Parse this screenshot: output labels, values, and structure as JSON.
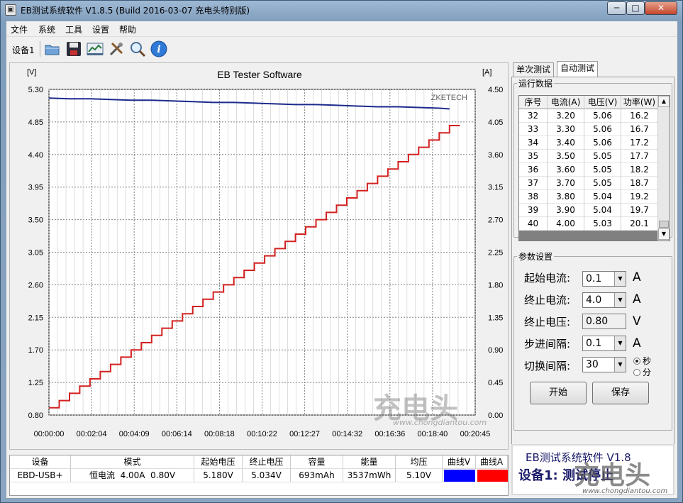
{
  "window": {
    "title": "EB测试系统软件 V1.8.5 (Build 2016-03-07 充电头特别版)",
    "controls": [
      "─",
      "□",
      "✕"
    ]
  },
  "menu": [
    "文件",
    "系统",
    "工具",
    "设置",
    "帮助"
  ],
  "toolbar": {
    "device_label": "设备1",
    "buttons": [
      "folder-icon",
      "save-icon",
      "chart-icon",
      "tools-icon",
      "zoom-icon",
      "info-icon"
    ]
  },
  "chart_data": {
    "type": "line",
    "title": "EB Tester Software",
    "brand_text": "ZKETECH",
    "left_unit": "[V]",
    "right_unit": "[A]",
    "y_left_ticks": [
      "5.30",
      "4.85",
      "4.40",
      "3.95",
      "3.50",
      "3.05",
      "2.60",
      "2.15",
      "1.70",
      "1.25",
      "0.80"
    ],
    "y_right_ticks": [
      "4.50",
      "4.05",
      "3.60",
      "3.15",
      "2.70",
      "2.25",
      "1.80",
      "1.35",
      "0.90",
      "0.45",
      "0.00"
    ],
    "x_ticks": [
      "00:00:00",
      "00:02:04",
      "00:04:09",
      "00:06:14",
      "00:08:18",
      "00:10:22",
      "00:12:27",
      "00:14:32",
      "00:16:36",
      "00:18:40",
      "00:20:45"
    ],
    "y_left_range": [
      0.8,
      5.3
    ],
    "y_right_range": [
      0.0,
      4.5
    ],
    "x_range_seconds": [
      0,
      1245
    ],
    "series": [
      {
        "name": "曲线V",
        "axis": "left",
        "color": "#1c2a8c",
        "x": [
          0,
          60,
          120,
          180,
          240,
          300,
          360,
          420,
          480,
          540,
          600,
          660,
          720,
          780,
          840,
          900,
          960,
          1020,
          1080,
          1140,
          1170
        ],
        "values": [
          5.18,
          5.17,
          5.17,
          5.16,
          5.15,
          5.15,
          5.14,
          5.13,
          5.12,
          5.12,
          5.11,
          5.1,
          5.09,
          5.09,
          5.08,
          5.07,
          5.06,
          5.06,
          5.05,
          5.04,
          5.03
        ]
      },
      {
        "name": "曲线A",
        "axis": "right",
        "color": "#d42020",
        "step": true,
        "step_seconds": 30,
        "start": 0.1,
        "increment": 0.1,
        "end": 4.0
      }
    ]
  },
  "tabs": [
    "单次测试",
    "自动测试"
  ],
  "run_data": {
    "group_title": "运行数据",
    "headers": [
      "序号",
      "电流(A)",
      "电压(V)",
      "功率(W)"
    ],
    "rows": [
      [
        "32",
        "3.20",
        "5.06",
        "16.2"
      ],
      [
        "33",
        "3.30",
        "5.06",
        "16.7"
      ],
      [
        "34",
        "3.40",
        "5.06",
        "17.2"
      ],
      [
        "35",
        "3.50",
        "5.05",
        "17.7"
      ],
      [
        "36",
        "3.60",
        "5.05",
        "18.2"
      ],
      [
        "37",
        "3.70",
        "5.05",
        "18.7"
      ],
      [
        "38",
        "3.80",
        "5.04",
        "19.2"
      ],
      [
        "39",
        "3.90",
        "5.04",
        "19.7"
      ],
      [
        "40",
        "4.00",
        "5.03",
        "20.1"
      ]
    ]
  },
  "params": {
    "group_title": "参数设置",
    "start_current": {
      "label": "起始电流:",
      "value": "0.1",
      "unit": "A"
    },
    "stop_current": {
      "label": "终止电流:",
      "value": "4.0",
      "unit": "A"
    },
    "stop_voltage": {
      "label": "终止电压:",
      "value": "0.80",
      "unit": "V"
    },
    "step_interval": {
      "label": "步进间隔:",
      "value": "0.1",
      "unit": "A"
    },
    "switch_interval": {
      "label": "切换间隔:",
      "value": "30"
    },
    "unit_sec": "秒",
    "unit_min": "分",
    "start_button": "开始",
    "save_button": "保存"
  },
  "status": {
    "line1": "EB测试系统软件 V1.8",
    "line2": "设备1: 测试停止"
  },
  "summary": {
    "headers": [
      "设备",
      "模式",
      "起始电压",
      "终止电压",
      "容量",
      "能量",
      "均压",
      "曲线V",
      "曲线A"
    ],
    "row": [
      "EBD-USB+",
      "恒电流  4.00A  0.80V",
      "5.180V",
      "5.034V",
      "693mAh",
      "3537mWh",
      "5.10V"
    ],
    "curve_v_color": "#0000ff",
    "curve_a_color": "#ff0000"
  },
  "watermark": {
    "text": "充电头",
    "url": "www.chongdiantou.com"
  }
}
